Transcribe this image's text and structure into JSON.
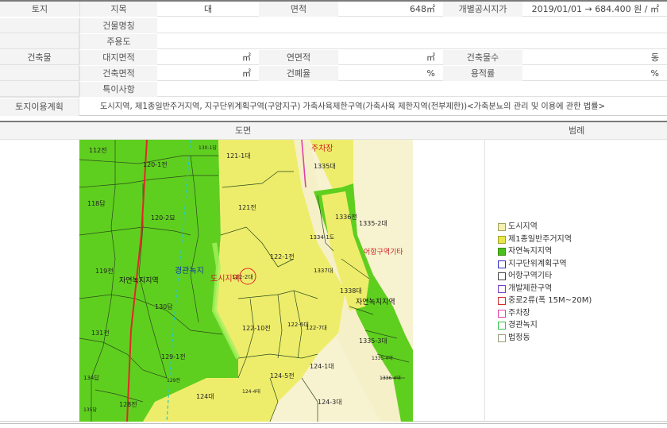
{
  "rows": {
    "land": {
      "label": "토지",
      "jimok_label": "지목",
      "jimok_value": "대",
      "area_label": "면적",
      "area_value": "648㎡",
      "price_label": "개별공시지가",
      "price_value": "2019/01/01 → 684.400 원 / ㎡"
    },
    "building": {
      "label": "건축물",
      "name_label": "건물명칭",
      "use_label": "주용도",
      "site_area_label": "대지면적",
      "site_area_unit": "㎡",
      "floor_area_label": "연면적",
      "floor_area_unit": "㎡",
      "floors_label": "건축물수",
      "floors_unit": "동",
      "building_area_label": "건축면적",
      "building_area_unit": "㎡",
      "coverage_label": "건폐율",
      "coverage_unit": "%",
      "far_label": "용적률",
      "far_unit": "%",
      "notes_label": "특이사항"
    },
    "landuse": {
      "label": "토지이용계획",
      "value": "도시지역, 제1종일반주거지역, 지구단위계획구역(구암지구) 가축사육제한구역(가축사육 제한지역(전부제한))<가축분뇨의 관리 및 이용에 관한 법률>"
    }
  },
  "map": {
    "header_map": "도면",
    "header_legend": "범례",
    "parcels": [
      "112전",
      "120-1전",
      "130-1답",
      "121-1대",
      "1335대",
      "118답",
      "120-2묘",
      "121전",
      "1336전",
      "1335-2대",
      "1334-1도",
      "119전",
      "122-1전",
      "122-2대",
      "1337대",
      "130답",
      "1338대",
      "122-10전",
      "122-6대",
      "122-7대",
      "131전",
      "1335-3대",
      "129-1전",
      "124-1대",
      "124-5전",
      "129전",
      "124대",
      "124-4대",
      "124-3대",
      "134답",
      "128전",
      "135답",
      "1335-4대",
      "1336-4대"
    ],
    "labels": {
      "nature_green_left": "자연녹지지역",
      "nature_green_right": "자연녹지지역",
      "landscape_green": "경관녹지",
      "urban_area": "도시지역",
      "parking": "주차장",
      "fishing_other": "어항구역기타"
    },
    "colors": {
      "green_zone": "#5fcf1f",
      "residential": "#eeed6b",
      "road_beige": "#f6f0c8"
    }
  },
  "legend": [
    {
      "label": "도시지역",
      "fill": "#f3f0b0",
      "border": "#a0a05a"
    },
    {
      "label": "제1종일반주거지역",
      "fill": "#e8e84a",
      "border": "#a0a030"
    },
    {
      "label": "자연녹지지역",
      "fill": "#4cbf1e",
      "border": "#3a8f10"
    },
    {
      "label": "지구단위계획구역",
      "fill": "#ffffff",
      "border": "#2b2bcc"
    },
    {
      "label": "어항구역기타",
      "fill": "#ffffff",
      "border": "#444444"
    },
    {
      "label": "개발제한구역",
      "fill": "#ffffff",
      "border": "#7a3fc8"
    },
    {
      "label": "중로2류(폭 15M~20M)",
      "fill": "#ffffff",
      "border": "#d23030"
    },
    {
      "label": "주차장",
      "fill": "#ffffff",
      "border": "#e040a8"
    },
    {
      "label": "경관녹지",
      "fill": "#ffffff",
      "border": "#36c04a"
    },
    {
      "label": "법정동",
      "fill": "#ffffff",
      "border": "#9a9a7a"
    }
  ]
}
